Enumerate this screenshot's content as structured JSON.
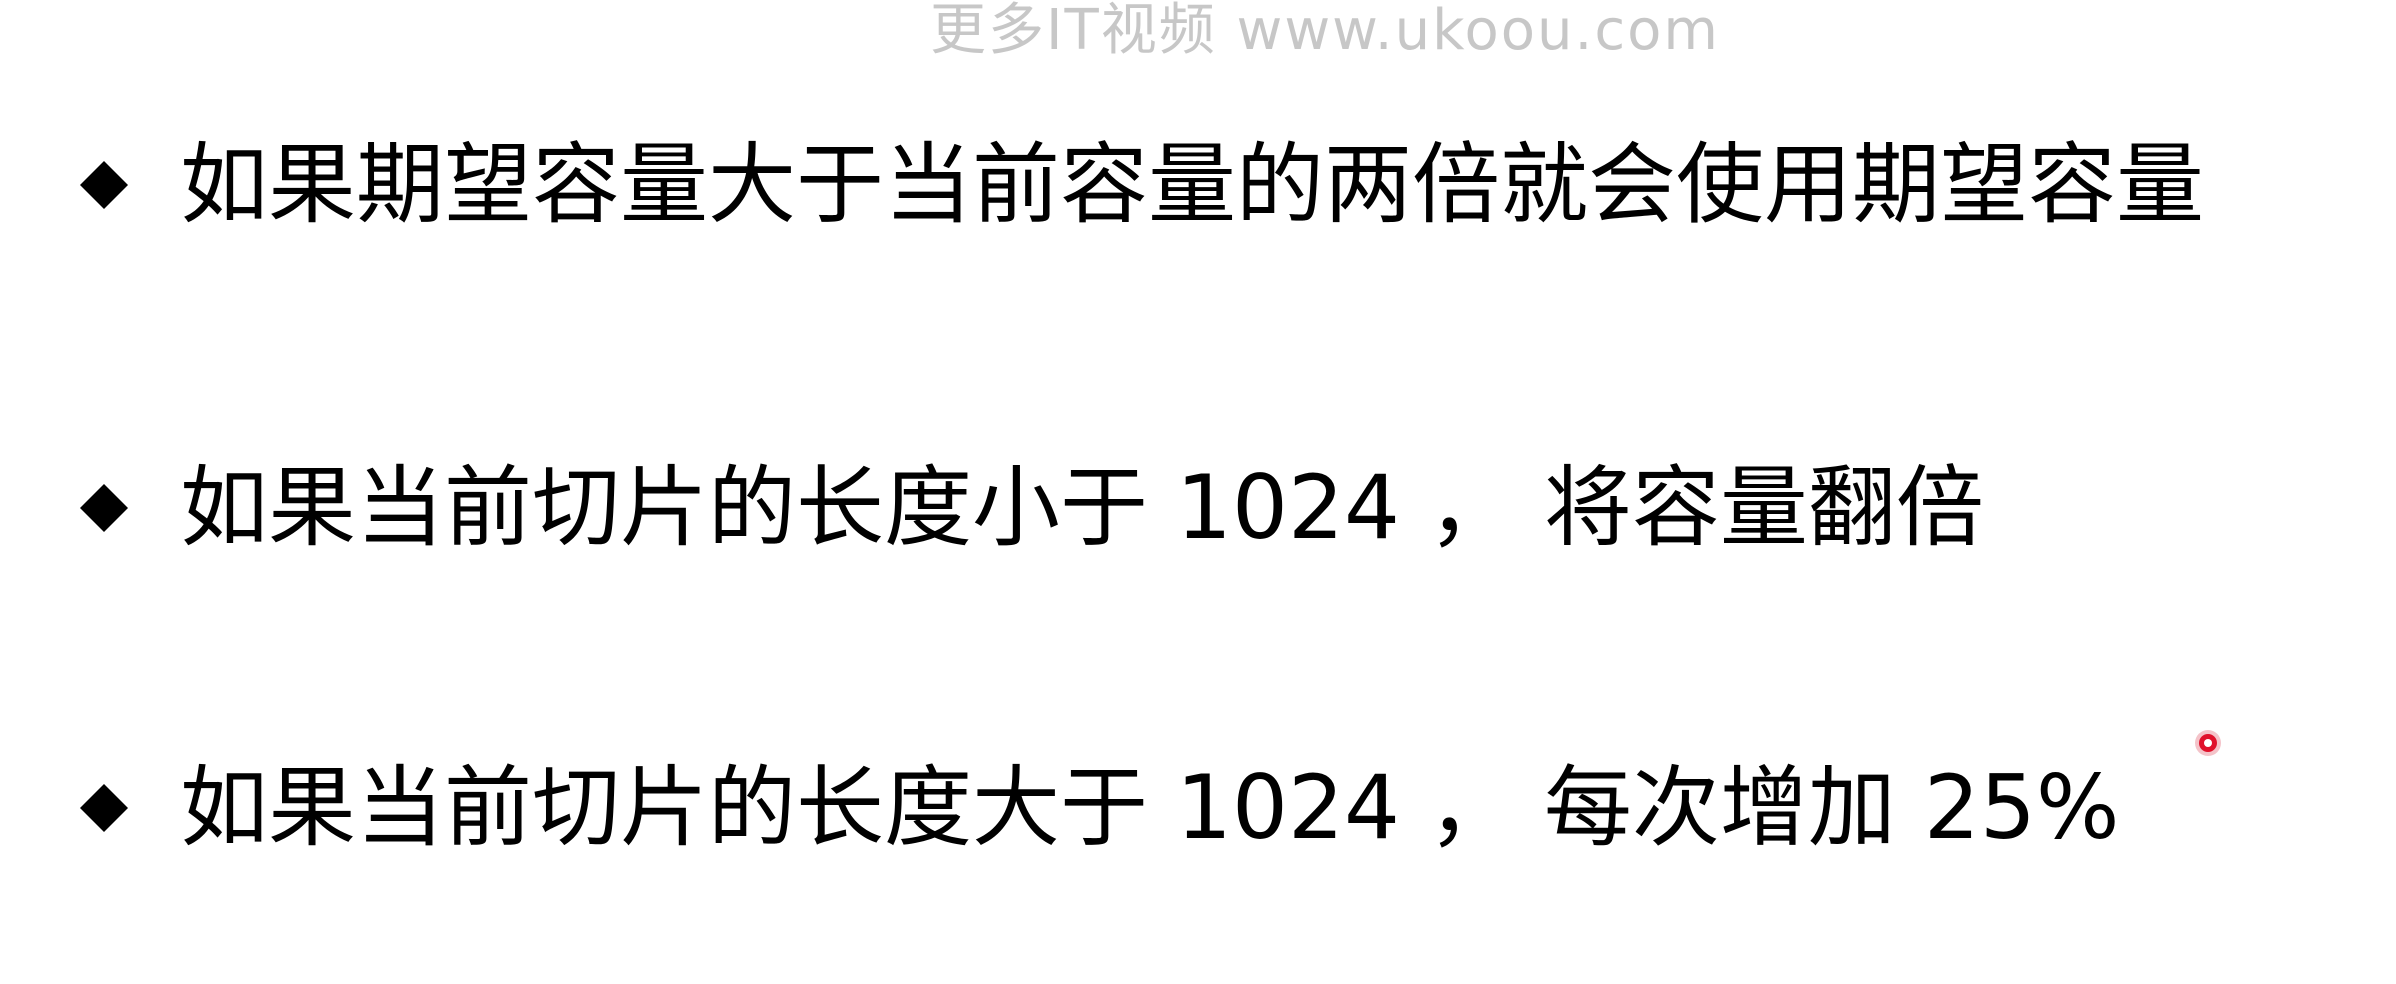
{
  "watermark": "更多IT视频 www.ukoou.com",
  "bullets": [
    {
      "text": "如果期望容量大于当前容量的两倍就会使用期望容量"
    },
    {
      "text": "如果当前切片的长度小于 1024 ， 将容量翻倍"
    },
    {
      "text": "如果当前切片的长度大于 1024 ， 每次增加 25%"
    }
  ],
  "colors": {
    "text": "#000000",
    "watermark": "#c7c7c7",
    "cursor": "#e0112b"
  },
  "icons": {
    "bullet": "diamond-bullet-icon",
    "cursor": "cursor-dot-icon"
  }
}
